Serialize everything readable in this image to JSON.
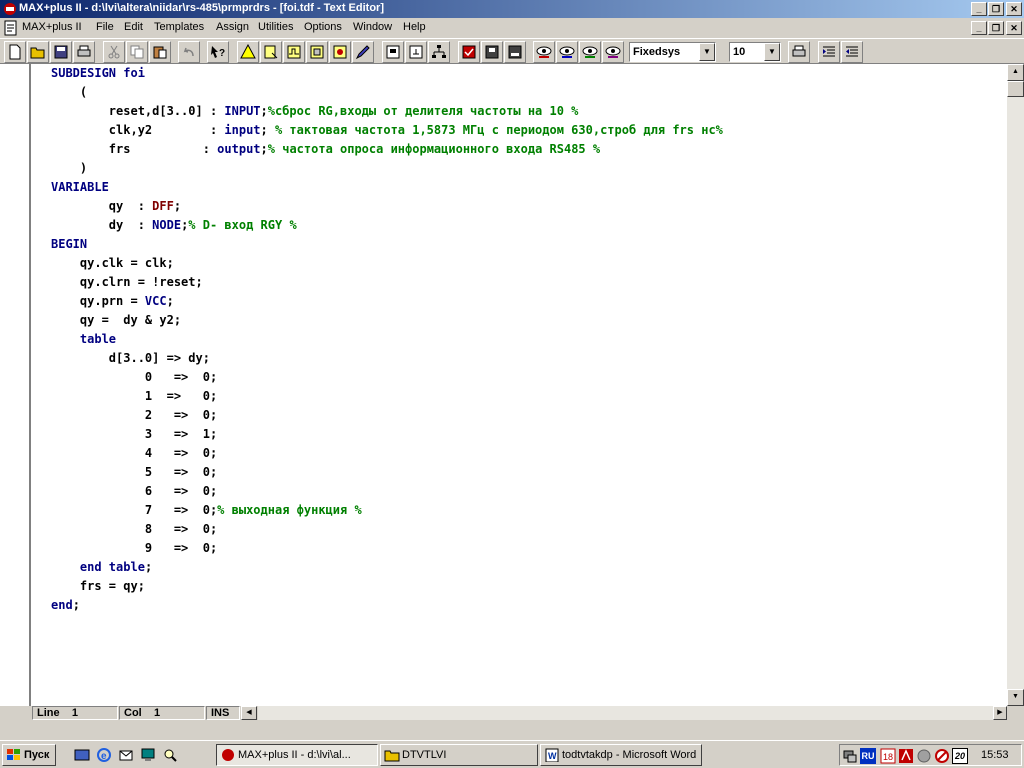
{
  "window": {
    "title": "MAX+plus II - d:\\lvi\\altera\\niidar\\rs-485\\prmprdrs - [foi.tdf - Text Editor]"
  },
  "menu": {
    "app_label": "MAX+plus II",
    "items": [
      "File",
      "Edit",
      "Templates",
      "Assign",
      "Utilities",
      "Options",
      "Window",
      "Help"
    ]
  },
  "toolbar": {
    "font_name": "Fixedsys",
    "font_size": "10"
  },
  "code_lines": [
    [
      {
        "t": "SUBDESIGN foi",
        "c": "kw"
      }
    ],
    [
      {
        "t": "    (",
        "c": ""
      }
    ],
    [
      {
        "t": "        reset,d[3..0] : ",
        "c": ""
      },
      {
        "t": "INPUT",
        "c": "kw"
      },
      {
        "t": ";",
        "c": ""
      },
      {
        "t": "%сброс RG,входы от делителя частоты на 10 %",
        "c": "cm"
      }
    ],
    [
      {
        "t": "        clk,y2        : ",
        "c": ""
      },
      {
        "t": "input",
        "c": "kw"
      },
      {
        "t": "; ",
        "c": ""
      },
      {
        "t": "% тактовая частота 1,5873 МГц с периодом 630,строб для frs нс%",
        "c": "cm"
      }
    ],
    [
      {
        "t": "        frs          : ",
        "c": ""
      },
      {
        "t": "output",
        "c": "kw"
      },
      {
        "t": ";",
        "c": ""
      },
      {
        "t": "% частота опроса информационного входа RS485 %",
        "c": "cm"
      }
    ],
    [
      {
        "t": "    )",
        "c": ""
      }
    ],
    [
      {
        "t": "VARIABLE",
        "c": "kw"
      }
    ],
    [
      {
        "t": "        qy  : ",
        "c": ""
      },
      {
        "t": "DFF",
        "c": "pr"
      },
      {
        "t": ";",
        "c": ""
      }
    ],
    [
      {
        "t": "        dy  : ",
        "c": ""
      },
      {
        "t": "NODE",
        "c": "kw"
      },
      {
        "t": ";",
        "c": ""
      },
      {
        "t": "% D- вход RGY %",
        "c": "cm"
      }
    ],
    [
      {
        "t": "BEGIN",
        "c": "kw"
      }
    ],
    [
      {
        "t": "    qy.clk = clk;",
        "c": ""
      }
    ],
    [
      {
        "t": "    qy.clrn = !reset;",
        "c": ""
      }
    ],
    [
      {
        "t": "    qy.prn = ",
        "c": ""
      },
      {
        "t": "VCC",
        "c": "kw"
      },
      {
        "t": ";",
        "c": ""
      }
    ],
    [
      {
        "t": "    qy =  dy & y2;",
        "c": ""
      }
    ],
    [
      {
        "t": "    table",
        "c": "kw"
      }
    ],
    [
      {
        "t": "        d[3..0] => dy;",
        "c": ""
      }
    ],
    [
      {
        "t": "             0   =>  0;",
        "c": ""
      }
    ],
    [
      {
        "t": "             1  =>   0;",
        "c": ""
      }
    ],
    [
      {
        "t": "             2   =>  0;",
        "c": ""
      }
    ],
    [
      {
        "t": "             3   =>  1;",
        "c": ""
      }
    ],
    [
      {
        "t": "             4   =>  0;",
        "c": ""
      }
    ],
    [
      {
        "t": "             5   =>  0;",
        "c": ""
      }
    ],
    [
      {
        "t": "             6   =>  0;",
        "c": ""
      }
    ],
    [
      {
        "t": "             7   =>  0;",
        "c": ""
      },
      {
        "t": "% выходная функция %",
        "c": "cm"
      }
    ],
    [
      {
        "t": "             8   =>  0;",
        "c": ""
      }
    ],
    [
      {
        "t": "             9   =>  0;",
        "c": ""
      }
    ],
    [
      {
        "t": "    ",
        "c": ""
      },
      {
        "t": "end table",
        "c": "kw"
      },
      {
        "t": ";",
        "c": ""
      }
    ],
    [
      {
        "t": "    frs = qy;",
        "c": ""
      }
    ],
    [
      {
        "t": "end",
        "c": "kw"
      },
      {
        "t": ";",
        "c": ""
      }
    ]
  ],
  "status": {
    "line_label": "Line",
    "line_value": "1",
    "col_label": "Col",
    "col_value": "1",
    "ins": "INS"
  },
  "taskbar": {
    "start_label": "Пуск",
    "tasks": [
      {
        "label": "MAX+plus II - d:\\lvi\\al...",
        "active": true
      },
      {
        "label": "DTVTLVI",
        "active": false
      },
      {
        "label": "todtvtakdp - Microsoft Word",
        "active": false
      }
    ],
    "tray_lang": "RU",
    "tray_date_icon": "20",
    "clock": "15:53"
  },
  "colors": {
    "keyword": "#000080",
    "comment": "#008000",
    "primitive": "#800000",
    "titlebar_start": "#0a246a",
    "titlebar_end": "#a6caf0"
  }
}
